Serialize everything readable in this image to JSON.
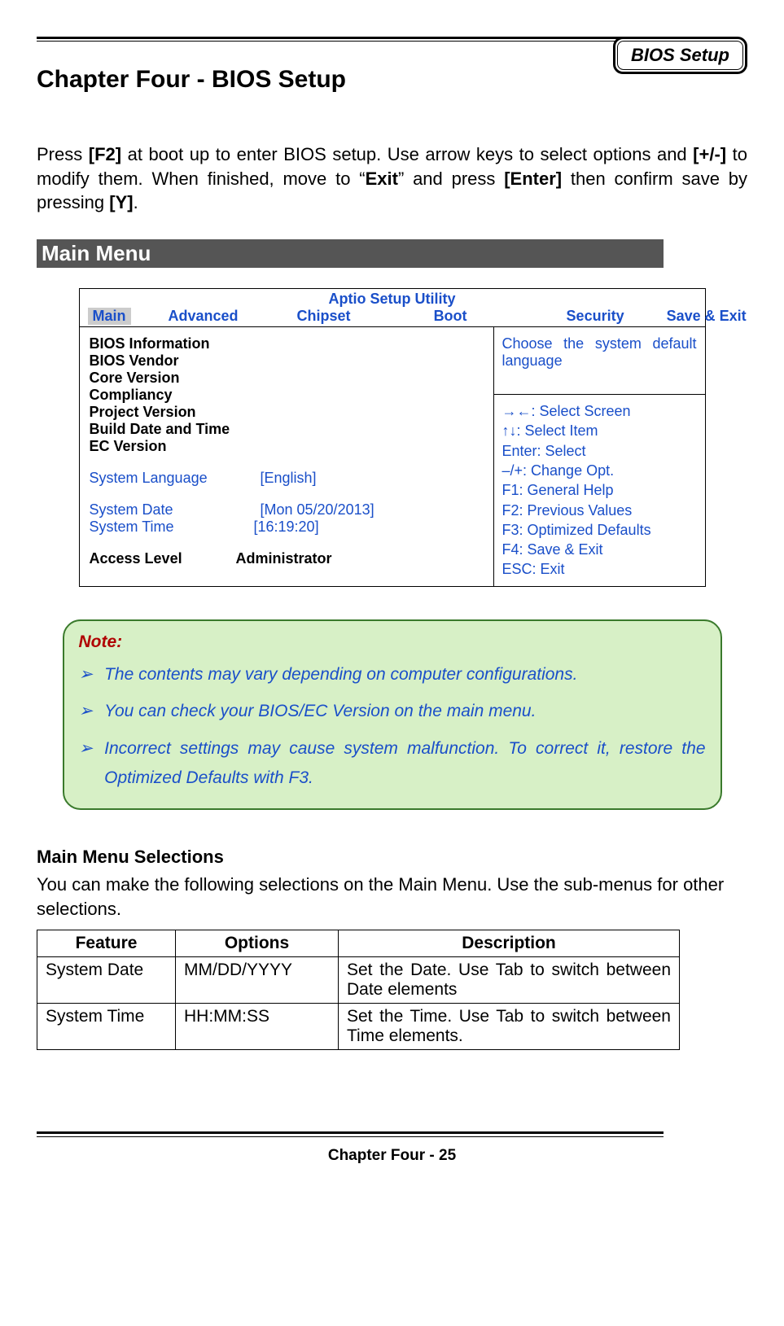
{
  "header": {
    "badge": "BIOS Setup"
  },
  "chapter_title": "Chapter Four - BIOS Setup",
  "intro": {
    "p1_a": "Press ",
    "p1_b": "[F2]",
    "p1_c": " at boot up to enter BIOS setup. Use arrow keys to select options and ",
    "p1_d": "[+/-]",
    "p1_e": " to modify them. When finished, move to “",
    "p1_f": "Exit",
    "p1_g": "” and press ",
    "p1_h": "[Enter]",
    "p1_i": " then confirm save by pressing ",
    "p1_j": "[Y]",
    "p1_k": "."
  },
  "section_bar": "Main Menu",
  "bios": {
    "utility_title": "Aptio Setup Utility",
    "tabs": [
      "Main",
      "Advanced",
      "Chipset",
      "Boot",
      "Security",
      "Save & Exit"
    ],
    "info_items": [
      "BIOS Information",
      "BIOS Vendor",
      "Core Version",
      "Compliancy",
      "Project Version",
      "Build Date and Time",
      "EC Version"
    ],
    "system_language_label": "System Language",
    "system_language_value": "[English]",
    "system_date_label": "System Date",
    "system_date_value": "[Mon 05/20/2013]",
    "system_time_label": "System Time",
    "system_time_value": "[16:19:20]",
    "access_level_label": "Access Level",
    "access_level_value": "Administrator",
    "help_top": "Choose the system default language",
    "help_keys": [
      "→←: Select Screen",
      "↑↓: Select Item",
      "Enter: Select",
      "–/+: Change Opt.",
      "F1: General Help",
      "F2: Previous Values",
      "F3: Optimized Defaults",
      "F4: Save & Exit",
      "ESC: Exit"
    ]
  },
  "note": {
    "title": "Note:",
    "items": [
      "The contents may vary depending on computer configurations.",
      "You can check your BIOS/EC Version on the main menu.",
      "Incorrect settings may cause system malfunction. To correct it, restore the Optimized Defaults with F3."
    ]
  },
  "selections": {
    "heading": "Main Menu Selections",
    "desc": "You can make the following selections on the Main Menu. Use the sub-menus for other selections.",
    "columns": [
      "Feature",
      "Options",
      "Description"
    ],
    "rows": [
      {
        "feature": "System Date",
        "options": "MM/DD/YYYY",
        "description": "Set the Date. Use Tab to switch between Date elements"
      },
      {
        "feature": "System Time",
        "options": "HH:MM:SS",
        "description": "Set the Time. Use Tab to switch between Time elements."
      }
    ]
  },
  "footer": "Chapter Four - 25"
}
